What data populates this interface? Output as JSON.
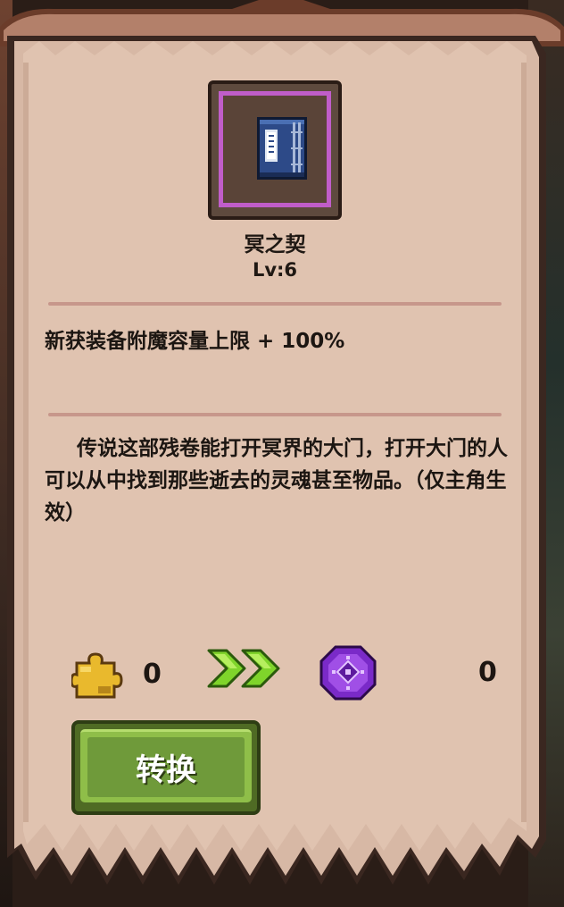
{
  "item": {
    "name": "冥之契",
    "level": "Lv:6",
    "icon": "blue-book-icon",
    "frame_color": "#c05dc9"
  },
  "effect": "新获装备附魔容量上限 + 100%",
  "description": "传说这部残卷能打开冥界的大门，打开大门的人可以从中找到那些逝去的灵魂甚至物品。（仅主角生效）",
  "conversion": {
    "from_icon": "puzzle-piece-icon",
    "from_count": "0",
    "arrow_icon": "double-chevron-right-icon",
    "to_icon": "purple-rune-icon",
    "to_count": "0",
    "button_label": "转换"
  },
  "colors": {
    "parchment": "#e0c3b0",
    "button_green": "#8fbe49",
    "arrow_green": "#7fd42b"
  }
}
